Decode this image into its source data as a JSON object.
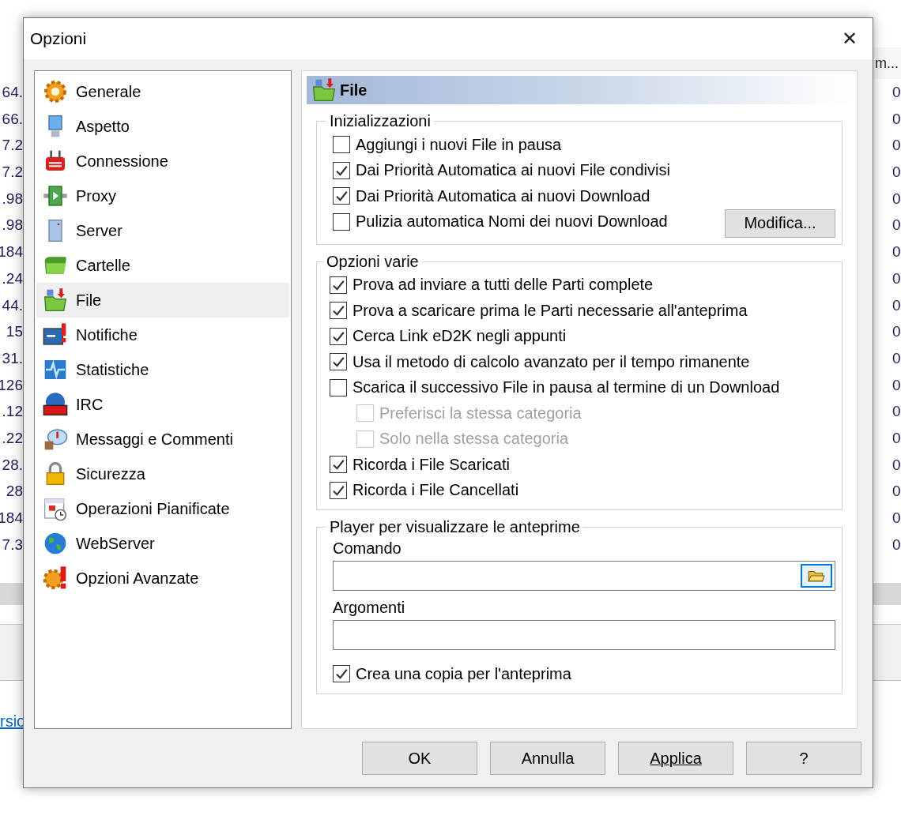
{
  "background": {
    "left_cells": [
      "64.",
      "66.",
      "7.2",
      "7.2",
      ".98",
      ".98",
      "184",
      ".24",
      "44.",
      "15",
      "31.",
      "126",
      ".12",
      ".22",
      "28.",
      "28",
      "184",
      "7.3"
    ],
    "right_header": "m...",
    "right_cells": [
      "0",
      "0",
      "0",
      "0",
      "0",
      "0",
      "0",
      "0",
      "0",
      "0",
      "0",
      "0",
      "0",
      "0",
      "0",
      "0",
      "0",
      "0"
    ],
    "link": "rsio"
  },
  "window": {
    "title": "Opzioni",
    "close": "✕"
  },
  "sidebar": {
    "items": [
      {
        "label": "Generale",
        "selected": false
      },
      {
        "label": "Aspetto",
        "selected": false
      },
      {
        "label": "Connessione",
        "selected": false
      },
      {
        "label": "Proxy",
        "selected": false
      },
      {
        "label": "Server",
        "selected": false
      },
      {
        "label": "Cartelle",
        "selected": false
      },
      {
        "label": "File",
        "selected": true
      },
      {
        "label": "Notifiche",
        "selected": false
      },
      {
        "label": "Statistiche",
        "selected": false
      },
      {
        "label": "IRC",
        "selected": false
      },
      {
        "label": "Messaggi e Commenti",
        "selected": false
      },
      {
        "label": "Sicurezza",
        "selected": false
      },
      {
        "label": "Operazioni Pianificate",
        "selected": false
      },
      {
        "label": "WebServer",
        "selected": false
      },
      {
        "label": "Opzioni Avanzate",
        "selected": false
      }
    ]
  },
  "header": {
    "title": "File"
  },
  "groups": [
    {
      "title": "Inizializzazioni",
      "options": [
        {
          "label": "Aggiungi i nuovi File in pausa",
          "checked": false,
          "disabled": false
        },
        {
          "label": "Dai Priorità Automatica ai nuovi File condivisi",
          "checked": true,
          "disabled": false
        },
        {
          "label": "Dai Priorità Automatica ai nuovi Download",
          "checked": true,
          "disabled": false
        },
        {
          "label": "Pulizia automatica Nomi dei nuovi Download",
          "checked": false,
          "disabled": false,
          "button": "Modifica..."
        }
      ]
    },
    {
      "title": "Opzioni varie",
      "options": [
        {
          "label": "Prova ad inviare a tutti delle Parti complete",
          "checked": true,
          "disabled": false
        },
        {
          "label": "Prova a scaricare prima le Parti necessarie all'anteprima",
          "checked": true,
          "disabled": false
        },
        {
          "label": "Cerca Link eD2K negli appunti",
          "checked": true,
          "disabled": false
        },
        {
          "label": "Usa il metodo di calcolo avanzato per il tempo rimanente",
          "checked": true,
          "disabled": false
        },
        {
          "label": "Scarica il successivo File in pausa al termine di un Download",
          "checked": false,
          "disabled": false,
          "children": [
            {
              "label": "Preferisci la stessa categoria",
              "checked": false,
              "disabled": true
            },
            {
              "label": "Solo nella stessa categoria",
              "checked": false,
              "disabled": true
            }
          ]
        },
        {
          "label": "Ricorda i File Scaricati",
          "checked": true,
          "disabled": false
        },
        {
          "label": "Ricorda i File Cancellati",
          "checked": true,
          "disabled": false
        }
      ]
    }
  ],
  "player": {
    "title": "Player per visualizzare le anteprime",
    "command_label": "Comando",
    "args_label": "Argomenti",
    "option": {
      "label": "Crea una copia per l'anteprima",
      "checked": true,
      "disabled": false
    }
  },
  "buttons": [
    {
      "label": "OK",
      "kind": "plain"
    },
    {
      "label": "Annulla",
      "kind": "plain"
    },
    {
      "label": "Applica",
      "kind": "accel"
    },
    {
      "label": "?",
      "kind": "plain"
    }
  ]
}
